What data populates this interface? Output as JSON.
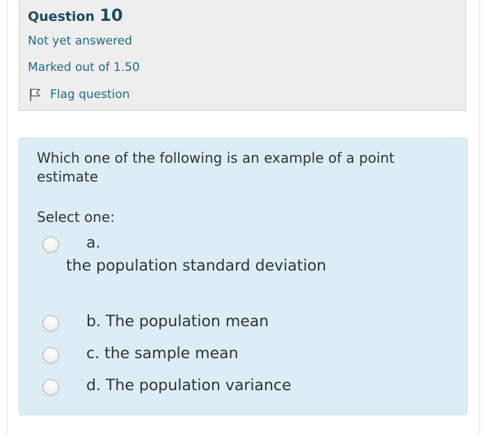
{
  "question": {
    "label": "Question",
    "number": "10",
    "state": "Not yet answered",
    "marks": "Marked out of 1.50",
    "flag_label": "Flag question",
    "flag_icon": "flag-icon"
  },
  "content": {
    "prompt": "Which one of the following is an example of a point estimate",
    "select_label": "Select one:",
    "options": [
      {
        "letter": "a.",
        "text": "the population standard deviation"
      },
      {
        "letter": "b.",
        "text": "The population mean"
      },
      {
        "letter": "c.",
        "text": "the sample mean"
      },
      {
        "letter": "d.",
        "text": "The population variance"
      }
    ]
  },
  "colors": {
    "info_background": "#eeeeee",
    "question_background": "#dcedf5",
    "title_color": "#1a4c63",
    "link_color": "#1f6a84",
    "text_color": "#333333"
  }
}
